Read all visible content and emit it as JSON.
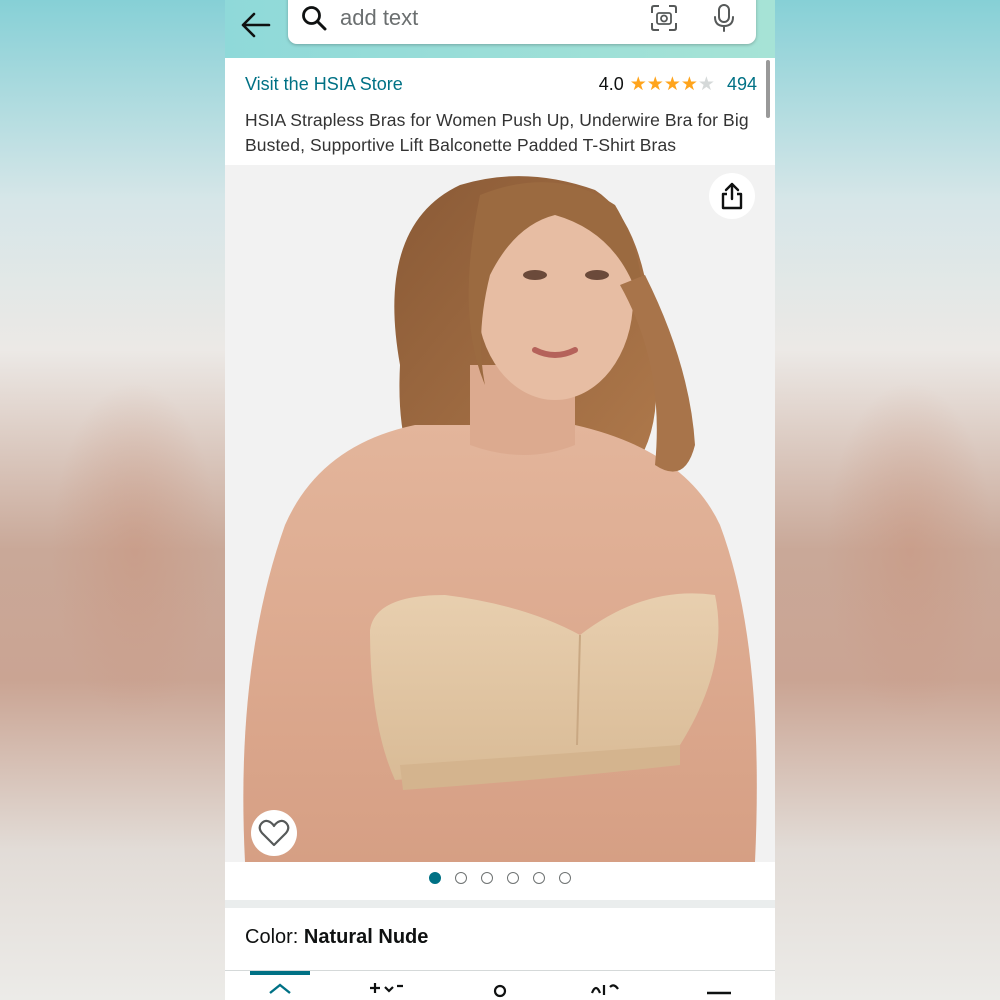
{
  "search": {
    "placeholder": "add text"
  },
  "store": {
    "link": "Visit the HSIA Store"
  },
  "rating": {
    "value": "4.0",
    "stars_filled": 4,
    "stars_total": 5,
    "count": "494"
  },
  "product": {
    "title": "HSIA Strapless Bras for Women Push Up, Underwire Bra for Big Busted, Supportive Lift Balconette Padded T-Shirt Bras"
  },
  "carousel": {
    "count": 6,
    "active": 0
  },
  "color": {
    "label": "Color: ",
    "value": "Natural Nude"
  },
  "icons": [
    "back-arrow-icon",
    "search-icon",
    "camera-icon",
    "mic-icon",
    "share-icon",
    "heart-icon",
    "home-icon",
    "ai-sparkle-icon",
    "profile-icon",
    "cart-icon",
    "menu-icon"
  ],
  "colors": {
    "link": "#007185",
    "star": "#ffa41c",
    "topbar": "#8fd9d9"
  }
}
